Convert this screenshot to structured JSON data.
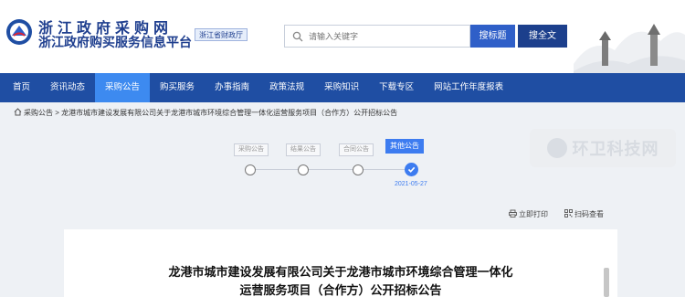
{
  "header": {
    "site_name": "浙江政府采购网",
    "platform_name": "浙江政府购买服务信息平台",
    "dept_badge": "浙江省财政厅",
    "search": {
      "placeholder": "请输入关键字",
      "value": ""
    },
    "btn_search_title": "搜标题",
    "btn_search_full": "搜全文"
  },
  "nav": {
    "items": [
      {
        "label": "首页"
      },
      {
        "label": "资讯动态"
      },
      {
        "label": "采购公告",
        "active": true
      },
      {
        "label": "购买服务"
      },
      {
        "label": "办事指南"
      },
      {
        "label": "政策法规"
      },
      {
        "label": "采购知识"
      },
      {
        "label": "下载专区"
      },
      {
        "label": "网站工作年度报表"
      }
    ]
  },
  "breadcrumb": {
    "section": "采购公告",
    "separator": ">",
    "current": "龙港市城市建设发展有限公司关于龙港市城市环境综合管理一体化运营服务项目（合作方）公开招标公告"
  },
  "progress": {
    "steps": [
      "采购公告",
      "结果公告",
      "合同公告",
      "其他公告"
    ],
    "active_step": "其他公告",
    "date": "2021-05-27"
  },
  "watermark": {
    "text": "环卫科技网"
  },
  "tools": {
    "print": "立即打印",
    "close": "扫码查看"
  },
  "document": {
    "title_line1": "龙港市城市建设发展有限公司关于龙港市城市环境综合管理一体化",
    "title_line2": "运营服务项目（合作方）公开招标公告"
  },
  "colors": {
    "nav_bg": "#1f4ea3",
    "nav_active": "#3d8af0",
    "accent": "#3d7cf0",
    "title_blue": "#1f3f8f"
  }
}
